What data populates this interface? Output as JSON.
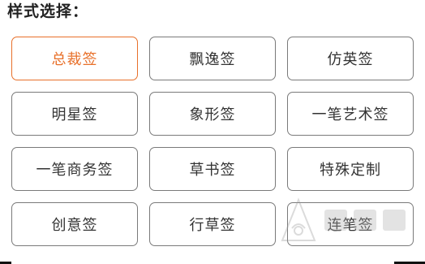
{
  "header": {
    "title": "样式选择："
  },
  "styles": [
    {
      "label": "总裁签",
      "selected": true
    },
    {
      "label": "飘逸签",
      "selected": false
    },
    {
      "label": "仿英签",
      "selected": false
    },
    {
      "label": "明星签",
      "selected": false
    },
    {
      "label": "象形签",
      "selected": false
    },
    {
      "label": "一笔艺术签",
      "selected": false
    },
    {
      "label": "一笔商务签",
      "selected": false
    },
    {
      "label": "草书签",
      "selected": false
    },
    {
      "label": "特殊定制",
      "selected": false
    },
    {
      "label": "创意签",
      "selected": false
    },
    {
      "label": "行草签",
      "selected": false
    },
    {
      "label": "连笔签",
      "selected": false
    }
  ],
  "colors": {
    "accent": "#e8702a",
    "border": "#7a7a7a",
    "text": "#333333"
  }
}
